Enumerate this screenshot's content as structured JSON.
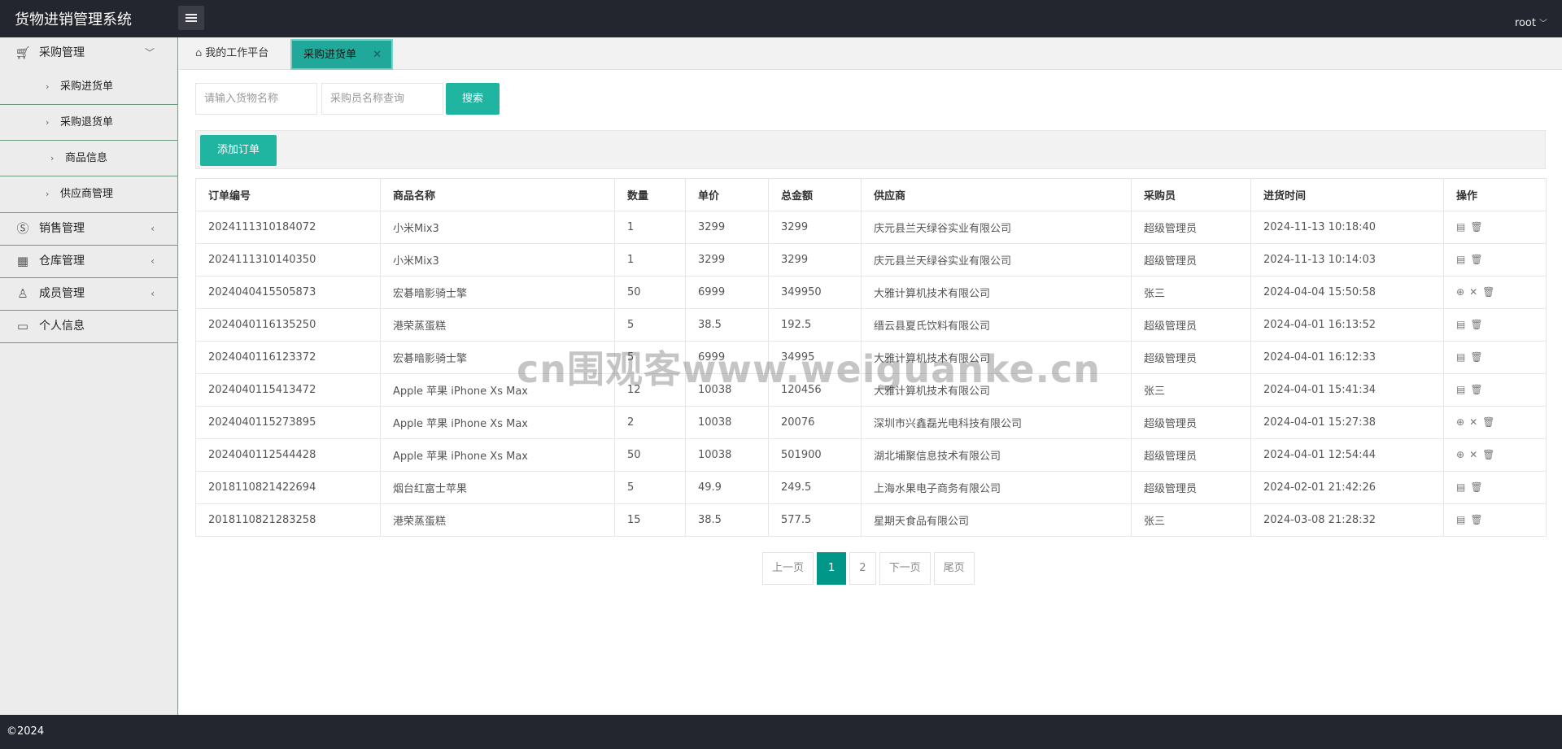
{
  "header": {
    "title": "货物进销管理系统",
    "user": "root"
  },
  "sidebar": {
    "groups": [
      {
        "label": "采购管理",
        "icon": "cart-icon",
        "expanded": true,
        "items": [
          "采购进货单",
          "采购退货单",
          "商品信息",
          "供应商管理"
        ]
      },
      {
        "label": "销售管理",
        "icon": "dollar-icon"
      },
      {
        "label": "仓库管理",
        "icon": "warehouse-icon"
      },
      {
        "label": "成员管理",
        "icon": "user-icon"
      },
      {
        "label": "个人信息",
        "icon": "id-card-icon"
      }
    ]
  },
  "tabs": {
    "home": "我的工作平台",
    "active": "采购进货单"
  },
  "search": {
    "goods_placeholder": "请输入货物名称",
    "buyer_placeholder": "采购员名称查询",
    "button": "搜索"
  },
  "toolbar": {
    "add_button": "添加订单"
  },
  "table": {
    "headers": [
      "订单编号",
      "商品名称",
      "数量",
      "单价",
      "总金额",
      "供应商",
      "采购员",
      "进货时间",
      "操作"
    ],
    "rows": [
      [
        "2024111310184072",
        "小米Mix3",
        "1",
        "3299",
        "3299",
        "庆元县兰天绿谷实业有限公司",
        "超级管理员",
        "2024-11-13 10:18:40"
      ],
      [
        "2024111310140350",
        "小米Mix3",
        "1",
        "3299",
        "3299",
        "庆元县兰天绿谷实业有限公司",
        "超级管理员",
        "2024-11-13 10:14:03"
      ],
      [
        "2024040415505873",
        "宏碁暗影骑士擎",
        "50",
        "6999",
        "349950",
        "大雅计算机技术有限公司",
        "张三",
        "2024-04-04 15:50:58"
      ],
      [
        "2024040116135250",
        "港荣蒸蛋糕",
        "5",
        "38.5",
        "192.5",
        "缙云县夏氏饮料有限公司",
        "超级管理员",
        "2024-04-01 16:13:52"
      ],
      [
        "2024040116123372",
        "宏碁暗影骑士擎",
        "5",
        "6999",
        "34995",
        "大雅计算机技术有限公司",
        "超级管理员",
        "2024-04-01 16:12:33"
      ],
      [
        "2024040115413472",
        "Apple 苹果 iPhone Xs Max",
        "12",
        "10038",
        "120456",
        "大雅计算机技术有限公司",
        "张三",
        "2024-04-01 15:41:34"
      ],
      [
        "2024040115273895",
        "Apple 苹果 iPhone Xs Max",
        "2",
        "10038",
        "20076",
        "深圳市兴鑫磊光电科技有限公司",
        "超级管理员",
        "2024-04-01 15:27:38"
      ],
      [
        "2024040112544428",
        "Apple 苹果 iPhone Xs Max",
        "50",
        "10038",
        "501900",
        "湖北埔聚信息技术有限公司",
        "超级管理员",
        "2024-04-01 12:54:44"
      ],
      [
        "2018110821422694",
        "烟台红富士苹果",
        "5",
        "49.9",
        "249.5",
        "上海水果电子商务有限公司",
        "超级管理员",
        "2024-02-01 21:42:26"
      ],
      [
        "2018110821283258",
        "港荣蒸蛋糕",
        "15",
        "38.5",
        "577.5",
        "星期天食品有限公司",
        "张三",
        "2024-03-08 21:28:32"
      ]
    ],
    "ops_types": [
      "edit",
      "edit",
      "full",
      "edit",
      "edit",
      "edit",
      "full",
      "full",
      "edit",
      "edit"
    ]
  },
  "pagination": {
    "prev": "上一页",
    "pages": [
      "1",
      "2"
    ],
    "current": "1",
    "next": "下一页",
    "last": "尾页"
  },
  "watermark": "cn围观客www.weiguanke.cn",
  "footer": {
    "copyright": "©2024"
  }
}
